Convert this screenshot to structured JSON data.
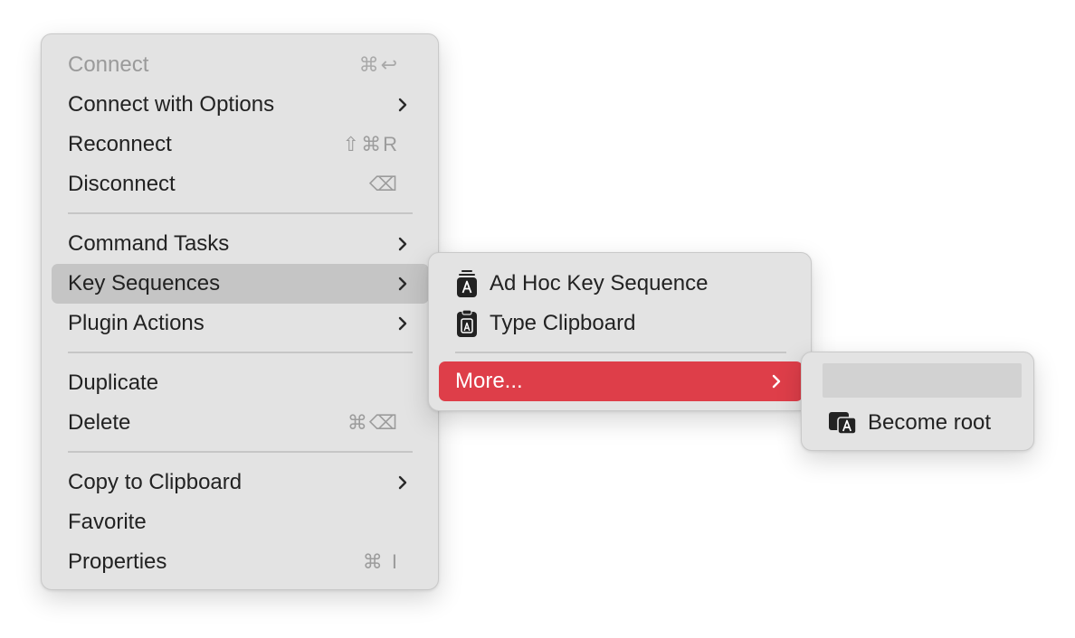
{
  "main_menu": {
    "connect": {
      "label": "Connect",
      "shortcut": "⌘↩"
    },
    "connect_options": {
      "label": "Connect with Options"
    },
    "reconnect": {
      "label": "Reconnect",
      "shortcut": "⇧⌘R"
    },
    "disconnect": {
      "label": "Disconnect",
      "shortcut": "⌫"
    },
    "command_tasks": {
      "label": "Command Tasks"
    },
    "key_sequences": {
      "label": "Key Sequences"
    },
    "plugin_actions": {
      "label": "Plugin Actions"
    },
    "duplicate": {
      "label": "Duplicate"
    },
    "delete": {
      "label": "Delete",
      "shortcut": "⌘⌫"
    },
    "copy_clipboard": {
      "label": "Copy to Clipboard"
    },
    "favorite": {
      "label": "Favorite"
    },
    "properties": {
      "label": "Properties",
      "shortcut": "⌘ I"
    }
  },
  "key_sequences_menu": {
    "ad_hoc": {
      "label": "Ad Hoc Key Sequence",
      "icon": "key-sequence-icon"
    },
    "type_clipboard": {
      "label": "Type Clipboard",
      "icon": "clipboard-key-icon"
    },
    "more": {
      "label": "More..."
    }
  },
  "more_menu": {
    "become_root": {
      "label": "Become root",
      "icon": "window-key-icon"
    }
  },
  "colors": {
    "menu_bg": "#e3e3e3",
    "hover_bg": "#c5c5c5",
    "selected_bg": "#de3e49",
    "text": "#222222",
    "disabled_text": "#9a9a9a"
  }
}
